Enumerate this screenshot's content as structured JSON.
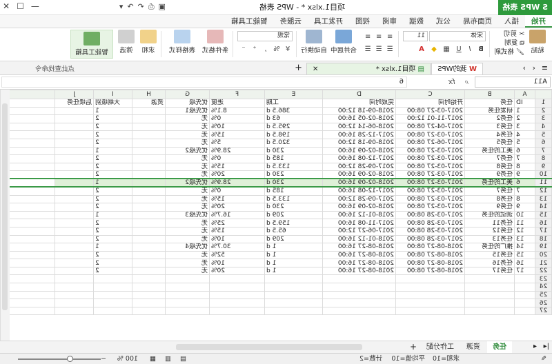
{
  "app": {
    "name": "WPS 表格",
    "doc_title": "项目1.xlsx * - WPS 表格",
    "brand_color": "#2e9a3c"
  },
  "quick_access": [
    "撤销",
    "重做",
    "打印",
    "保存",
    "更多"
  ],
  "ribbon_tabs": [
    "开始",
    "插入",
    "页面布局",
    "公式",
    "数据",
    "审阅",
    "视图",
    "开发工具",
    "云服务",
    "智能工具箱"
  ],
  "ribbon": {
    "paste": "粘贴",
    "cut": "剪切",
    "copy": "复制",
    "format_painter": "格式刷",
    "font": "宋体",
    "font_size": "11",
    "number_format": "常规",
    "merge": "合并居中",
    "wrap": "自动换行",
    "cond_format": "条件格式",
    "table_style": "表格样式",
    "sum": "求和",
    "filter": "筛选",
    "smart_toolbox": "智能工具箱"
  },
  "doc_tabs": [
    "我的WPS",
    "项目1.xlsx *"
  ],
  "formula_bar": {
    "cell": "A11",
    "fx": "fx",
    "value": "6",
    "search_hint": "点此查找命令"
  },
  "columns": [
    "A",
    "B",
    "C",
    "D",
    "E",
    "F",
    "G",
    "H",
    "I",
    "J"
  ],
  "headers": [
    "ID",
    "任务",
    "开始时间",
    "完成时间",
    "工期",
    "进度",
    "优先级",
    "资源",
    "大纲级别",
    "后续任务"
  ],
  "rows": [
    [
      "1",
      "研发任务",
      "2017-03-27 08:00",
      "2018-09-18 12:00",
      "386.5 d",
      "8.1%",
      "优先级1",
      "",
      "1",
      ""
    ],
    [
      "2",
      "任务2",
      "2017-11-01 12:00",
      "2018-02-05 16:00",
      "63 d",
      "0%",
      "无",
      "",
      "2",
      ""
    ],
    [
      "3",
      "任务3",
      "2017-04-27 08:00",
      "2018-06-14 12:00",
      "295.5 d",
      "10%",
      "无",
      "",
      "2",
      ""
    ],
    [
      "4",
      "任务4",
      "2017-03-27 08:00",
      "2017-12-28 16:00",
      "198.5 d",
      "15%",
      "无",
      "",
      "2",
      ""
    ],
    [
      "5",
      "任务5",
      "2017-06-27 08:00",
      "2018-09-18 12:00",
      "320.5 d",
      "5%",
      "无",
      "",
      "2",
      ""
    ],
    [
      "6",
      "美工的任务",
      "2017-03-27 08:00",
      "2018-02-09 16:00",
      "230 d",
      "28.9%",
      "优先级2",
      "",
      "1",
      ""
    ],
    [
      "7",
      "任务7",
      "2017-03-27 08:00",
      "2017-12-08 16:00",
      "185 d",
      "0%",
      "无",
      "",
      "2",
      ""
    ],
    [
      "8",
      "任务8",
      "2017-03-27 08:00",
      "2017-09-28 12:00",
      "133.5 d",
      "15%",
      "无",
      "",
      "2",
      ""
    ],
    [
      "9",
      "任务9",
      "2017-03-27 08:00",
      "2018-02-09 16:00",
      "230 d",
      "20%",
      "无",
      "",
      "2",
      ""
    ],
    [
      "6",
      "美工的任务",
      "2017-03-27 08:00",
      "2018-02-09 16:00",
      "230 d",
      "28.9%",
      "优先级2",
      "",
      "1",
      ""
    ],
    [
      "7",
      "任务7",
      "2017-03-27 08:00",
      "2017-12-08 16:00",
      "185 d",
      "0%",
      "无",
      "",
      "2",
      ""
    ],
    [
      "8",
      "任务8",
      "2017-03-27 08:00",
      "2017-09-28 12:00",
      "133.5 d",
      "15%",
      "无",
      "",
      "2",
      ""
    ],
    [
      "9",
      "任务9",
      "2017-03-27 08:00",
      "2018-02-09 16:00",
      "230 d",
      "20%",
      "无",
      "",
      "2",
      ""
    ],
    [
      "10",
      "测试的任务",
      "2017-03-28 08:00",
      "2018-01-12 16:00",
      "209 d",
      "16.7%",
      "优先级3",
      "",
      "1",
      ""
    ],
    [
      "11",
      "任务11",
      "2017-03-28 08:00",
      "2017-11-08 16:00",
      "159.5 d",
      "25%",
      "无",
      "",
      "2",
      ""
    ],
    [
      "12",
      "任务12",
      "2017-03-28 08:00",
      "2017-06-27 12:00",
      "65.5 d",
      "15%",
      "无",
      "",
      "2",
      ""
    ],
    [
      "13",
      "任务13",
      "2017-03-28 08:00",
      "2018-01-12 16:00",
      "209 d",
      "10%",
      "无",
      "",
      "2",
      ""
    ],
    [
      "14",
      "推广的任务",
      "2018-08-27 08:00",
      "2018-08-27 16:00",
      "1 d",
      "30.7%",
      "优先级4",
      "",
      "1",
      ""
    ],
    [
      "15",
      "任务15",
      "2018-08-27 08:00",
      "2018-08-27 16:00",
      "1 d",
      "52%",
      "无",
      "",
      "2",
      ""
    ],
    [
      "16",
      "任务16",
      "2018-08-27 08:00",
      "2018-08-27 16:00",
      "1 d",
      "10%",
      "无",
      "",
      "2",
      ""
    ],
    [
      "17",
      "任务17",
      "2018-08-27 08:00",
      "2018-08-27 16:00",
      "1 d",
      "20%",
      "无",
      "",
      "2",
      ""
    ]
  ],
  "empty_rows": [
    "23",
    "24",
    "25",
    "26",
    "27"
  ],
  "sheets": [
    "任务",
    "资源",
    "工作分配"
  ],
  "status": {
    "sum": "求和=10",
    "avg": "平均值=10",
    "count": "计数=2",
    "zoom": "100 %"
  }
}
